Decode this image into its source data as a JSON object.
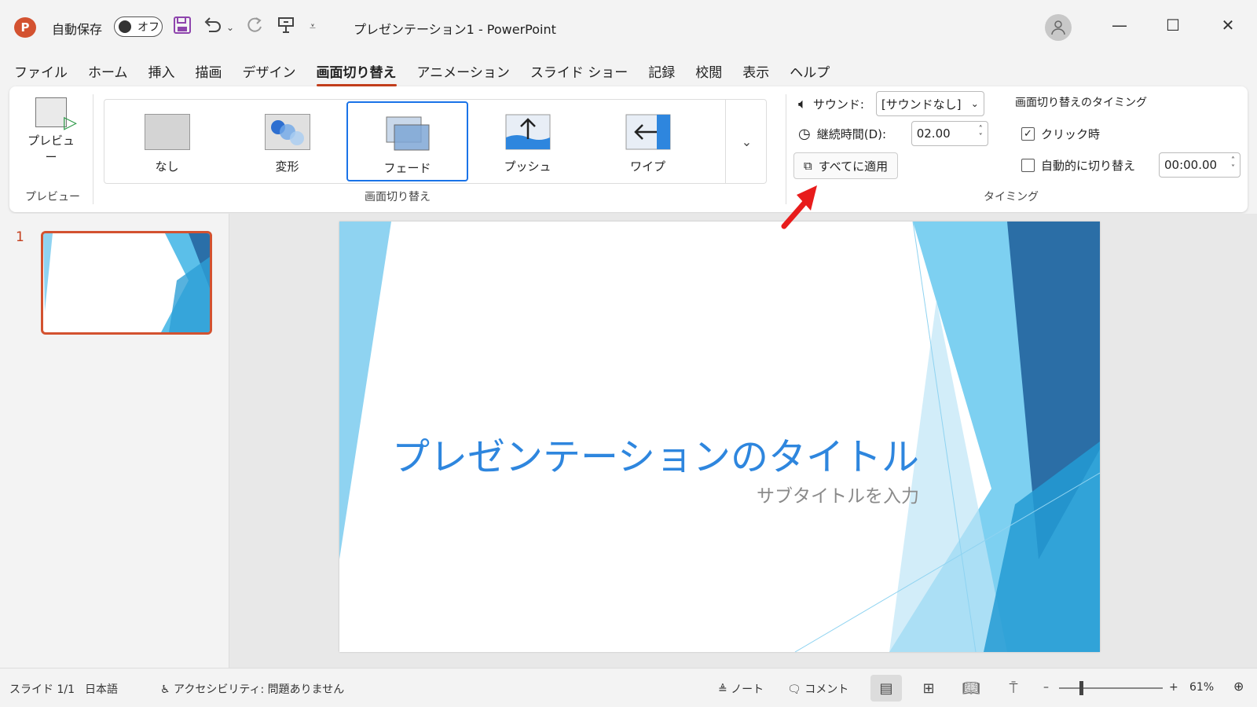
{
  "titlebar": {
    "logo_letter": "P",
    "autosave_label": "自動保存",
    "autosave_state": "オフ",
    "doc_title": "プレゼンテーション1  -  PowerPoint",
    "icons": [
      "save-icon",
      "undo-icon",
      "redo-icon",
      "slideshow-icon",
      "customize-icon"
    ]
  },
  "tabs": [
    "ファイル",
    "ホーム",
    "挿入",
    "描画",
    "デザイン",
    "画面切り替え",
    "アニメーション",
    "スライド ショー",
    "記録",
    "校閲",
    "表示",
    "ヘルプ"
  ],
  "active_tab": "画面切り替え",
  "ribbon": {
    "preview": {
      "button": "プレビュー",
      "group": "プレビュー"
    },
    "transitions": {
      "group": "画面切り替え",
      "items": [
        "なし",
        "変形",
        "フェード",
        "プッシュ",
        "ワイプ"
      ],
      "selected": "フェード"
    },
    "timing": {
      "group": "タイミング",
      "sound_label": "サウンド:",
      "sound_value": "[サウンドなし]",
      "duration_label": "継続時間(D):",
      "duration_value": "02.00",
      "apply_all": "すべてに適用",
      "advance_header": "画面切り替えのタイミング",
      "on_click_label": "クリック時",
      "on_click_checked": true,
      "after_label": "自動的に切り替え",
      "after_value": "00:00.00",
      "after_checked": false
    }
  },
  "thumbnails": {
    "slide_number": "1"
  },
  "slide": {
    "title": "プレゼンテーションのタイトル",
    "subtitle": "サブタイトルを入力"
  },
  "status": {
    "slide_count": "スライド 1/1",
    "language": "日本語",
    "accessibility": "アクセシビリティ: 問題ありません",
    "notes": "ノート",
    "comments": "コメント",
    "zoom": "61%"
  },
  "colors": {
    "accent": "#c43e1c",
    "selection": "#1a73e8",
    "title_blue": "#2e86de",
    "arrow_red": "#e81c1c"
  }
}
